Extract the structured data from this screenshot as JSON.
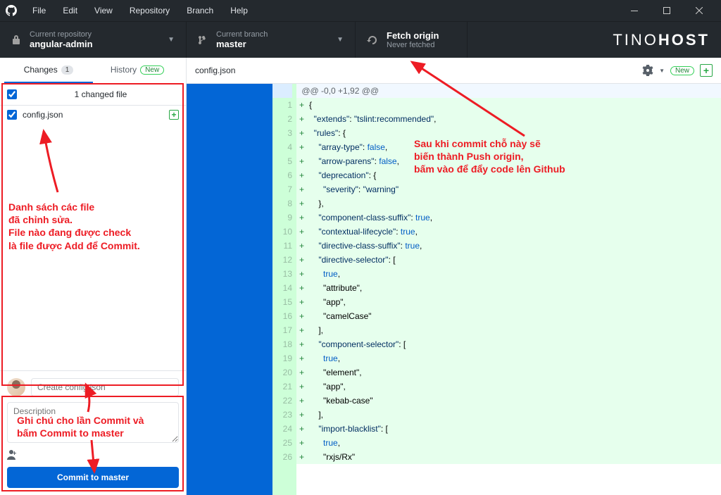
{
  "menu": {
    "file": "File",
    "edit": "Edit",
    "view": "View",
    "repository": "Repository",
    "branch": "Branch",
    "help": "Help"
  },
  "toolbar": {
    "repo_label": "Current repository",
    "repo_value": "angular-admin",
    "branch_label": "Current branch",
    "branch_value": "master",
    "fetch_label": "Fetch origin",
    "fetch_value": "Never fetched",
    "brand_left": "TINO",
    "brand_right": "HOST"
  },
  "tabs": {
    "changes": "Changes",
    "changes_count": "1",
    "history": "History",
    "new_badge": "New"
  },
  "changes": {
    "header": "1 changed file",
    "file": "config.json"
  },
  "commit": {
    "summary_placeholder": "Create config.json",
    "description_placeholder": "Description",
    "button_prefix": "Commit to ",
    "button_branch": "master"
  },
  "content": {
    "filename": "config.json",
    "new_badge": "New"
  },
  "diff": {
    "hunk": "@@ -0,0 +1,92 @@",
    "lines": [
      "+{",
      "+  \"extends\": \"tslint:recommended\",",
      "+  \"rules\": {",
      "+    \"array-type\": false,",
      "+    \"arrow-parens\": false,",
      "+    \"deprecation\": {",
      "+      \"severity\": \"warning\"",
      "+    },",
      "+    \"component-class-suffix\": true,",
      "+    \"contextual-lifecycle\": true,",
      "+    \"directive-class-suffix\": true,",
      "+    \"directive-selector\": [",
      "+      true,",
      "+      \"attribute\",",
      "+      \"app\",",
      "+      \"camelCase\"",
      "+    ],",
      "+    \"component-selector\": [",
      "+      true,",
      "+      \"element\",",
      "+      \"app\",",
      "+      \"kebab-case\"",
      "+    ],",
      "+    \"import-blacklist\": [",
      "+      true,",
      "+      \"rxjs/Rx\""
    ]
  },
  "annotations": {
    "fetch_note": "Sau khi commit chỗ này sẽ\nbiến thành Push origin,\nbấm vào để đẩy code lên Github",
    "files_note": "Danh sách các file\nđã chỉnh sửa.\nFile nào đang được check\nlà file được Add để Commit.",
    "commit_note": "Ghi chú cho lần Commit và\nbấm Commit to master"
  }
}
